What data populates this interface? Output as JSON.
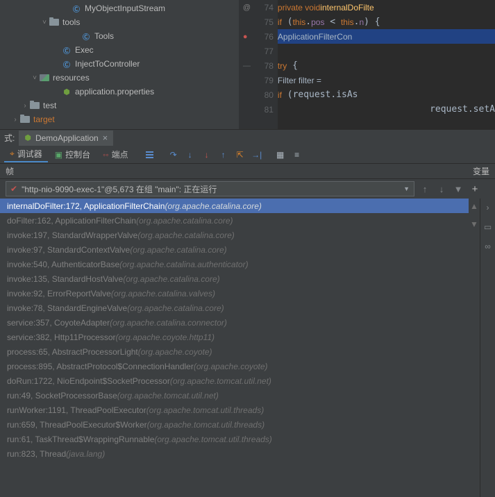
{
  "tree": {
    "items": [
      {
        "indent": 90,
        "arrow": "",
        "icon": "class",
        "label": "MyObjectInputStream"
      },
      {
        "indent": 58,
        "arrow": "˅",
        "icon": "folder",
        "label": "tools"
      },
      {
        "indent": 104,
        "arrow": "",
        "icon": "class",
        "label": "Tools"
      },
      {
        "indent": 76,
        "arrow": "",
        "icon": "class",
        "label": "Exec"
      },
      {
        "indent": 76,
        "arrow": "",
        "icon": "class",
        "label": "InjectToController"
      },
      {
        "indent": 44,
        "arrow": "˅",
        "icon": "res",
        "label": "resources"
      },
      {
        "indent": 76,
        "arrow": "",
        "icon": "prop",
        "label": "application.properties"
      },
      {
        "indent": 30,
        "arrow": "›",
        "icon": "folder",
        "label": "test"
      },
      {
        "indent": 16,
        "arrow": "›",
        "icon": "folder",
        "label": "target",
        "cls": "target-label"
      }
    ]
  },
  "code": {
    "lines": [
      {
        "n": 74,
        "mark": "@",
        "html": "            <span class='kw'>private void</span> <span class='fn'>internalDoFilte</span>"
      },
      {
        "n": 75,
        "mark": "",
        "html": "                <span class='kw'>if</span> (<span class='kw'>this</span>.<span class='field'>pos</span> &lt; <span class='kw'>this</span>.<span class='field'>n</span>) {"
      },
      {
        "n": 76,
        "mark": "●",
        "sel": true,
        "html": "                    <span class='ident'>ApplicationFilterCon</span>"
      },
      {
        "n": 77,
        "mark": "",
        "html": ""
      },
      {
        "n": 78,
        "mark": "—",
        "html": "                    <span class='kw'>try</span> {"
      },
      {
        "n": 79,
        "mark": "",
        "html": "                        <span class='ident'>Filter filter =</span>"
      },
      {
        "n": 80,
        "mark": "",
        "html": "                        <span class='kw'>if</span> (request.isAs"
      },
      {
        "n": 81,
        "mark": "",
        "html": "                            request.setA"
      }
    ]
  },
  "tabstrip": {
    "prefix": "式:",
    "name": "DemoApplication",
    "close": "×"
  },
  "toolbar": {
    "tabs": [
      {
        "icon": "orange",
        "label": "调试器",
        "active": true
      },
      {
        "icon": "green",
        "label": "控制台"
      },
      {
        "icon": "red",
        "label": "端点"
      }
    ]
  },
  "frames": {
    "header": "帧",
    "vars": "变量"
  },
  "thread": {
    "text": "\"http-nio-9090-exec-1\"@5,673 在组 \"main\": 正在运行"
  },
  "stack": [
    {
      "main": "internalDoFilter:172, ApplicationFilterChain ",
      "pkg": "(org.apache.catalina.core)",
      "sel": true
    },
    {
      "main": "doFilter:162, ApplicationFilterChain ",
      "pkg": "(org.apache.catalina.core)"
    },
    {
      "main": "invoke:197, StandardWrapperValve ",
      "pkg": "(org.apache.catalina.core)"
    },
    {
      "main": "invoke:97, StandardContextValve ",
      "pkg": "(org.apache.catalina.core)"
    },
    {
      "main": "invoke:540, AuthenticatorBase ",
      "pkg": "(org.apache.catalina.authenticator)"
    },
    {
      "main": "invoke:135, StandardHostValve ",
      "pkg": "(org.apache.catalina.core)"
    },
    {
      "main": "invoke:92, ErrorReportValve ",
      "pkg": "(org.apache.catalina.valves)"
    },
    {
      "main": "invoke:78, StandardEngineValve ",
      "pkg": "(org.apache.catalina.core)"
    },
    {
      "main": "service:357, CoyoteAdapter ",
      "pkg": "(org.apache.catalina.connector)"
    },
    {
      "main": "service:382, Http11Processor ",
      "pkg": "(org.apache.coyote.http11)"
    },
    {
      "main": "process:65, AbstractProcessorLight ",
      "pkg": "(org.apache.coyote)"
    },
    {
      "main": "process:895, AbstractProtocol$ConnectionHandler ",
      "pkg": "(org.apache.coyote)"
    },
    {
      "main": "doRun:1722, NioEndpoint$SocketProcessor ",
      "pkg": "(org.apache.tomcat.util.net)"
    },
    {
      "main": "run:49, SocketProcessorBase ",
      "pkg": "(org.apache.tomcat.util.net)"
    },
    {
      "main": "runWorker:1191, ThreadPoolExecutor ",
      "pkg": "(org.apache.tomcat.util.threads)"
    },
    {
      "main": "run:659, ThreadPoolExecutor$Worker ",
      "pkg": "(org.apache.tomcat.util.threads)"
    },
    {
      "main": "run:61, TaskThread$WrappingRunnable ",
      "pkg": "(org.apache.tomcat.util.threads)"
    },
    {
      "main": "run:823, Thread ",
      "pkg": "(java.lang)"
    }
  ]
}
